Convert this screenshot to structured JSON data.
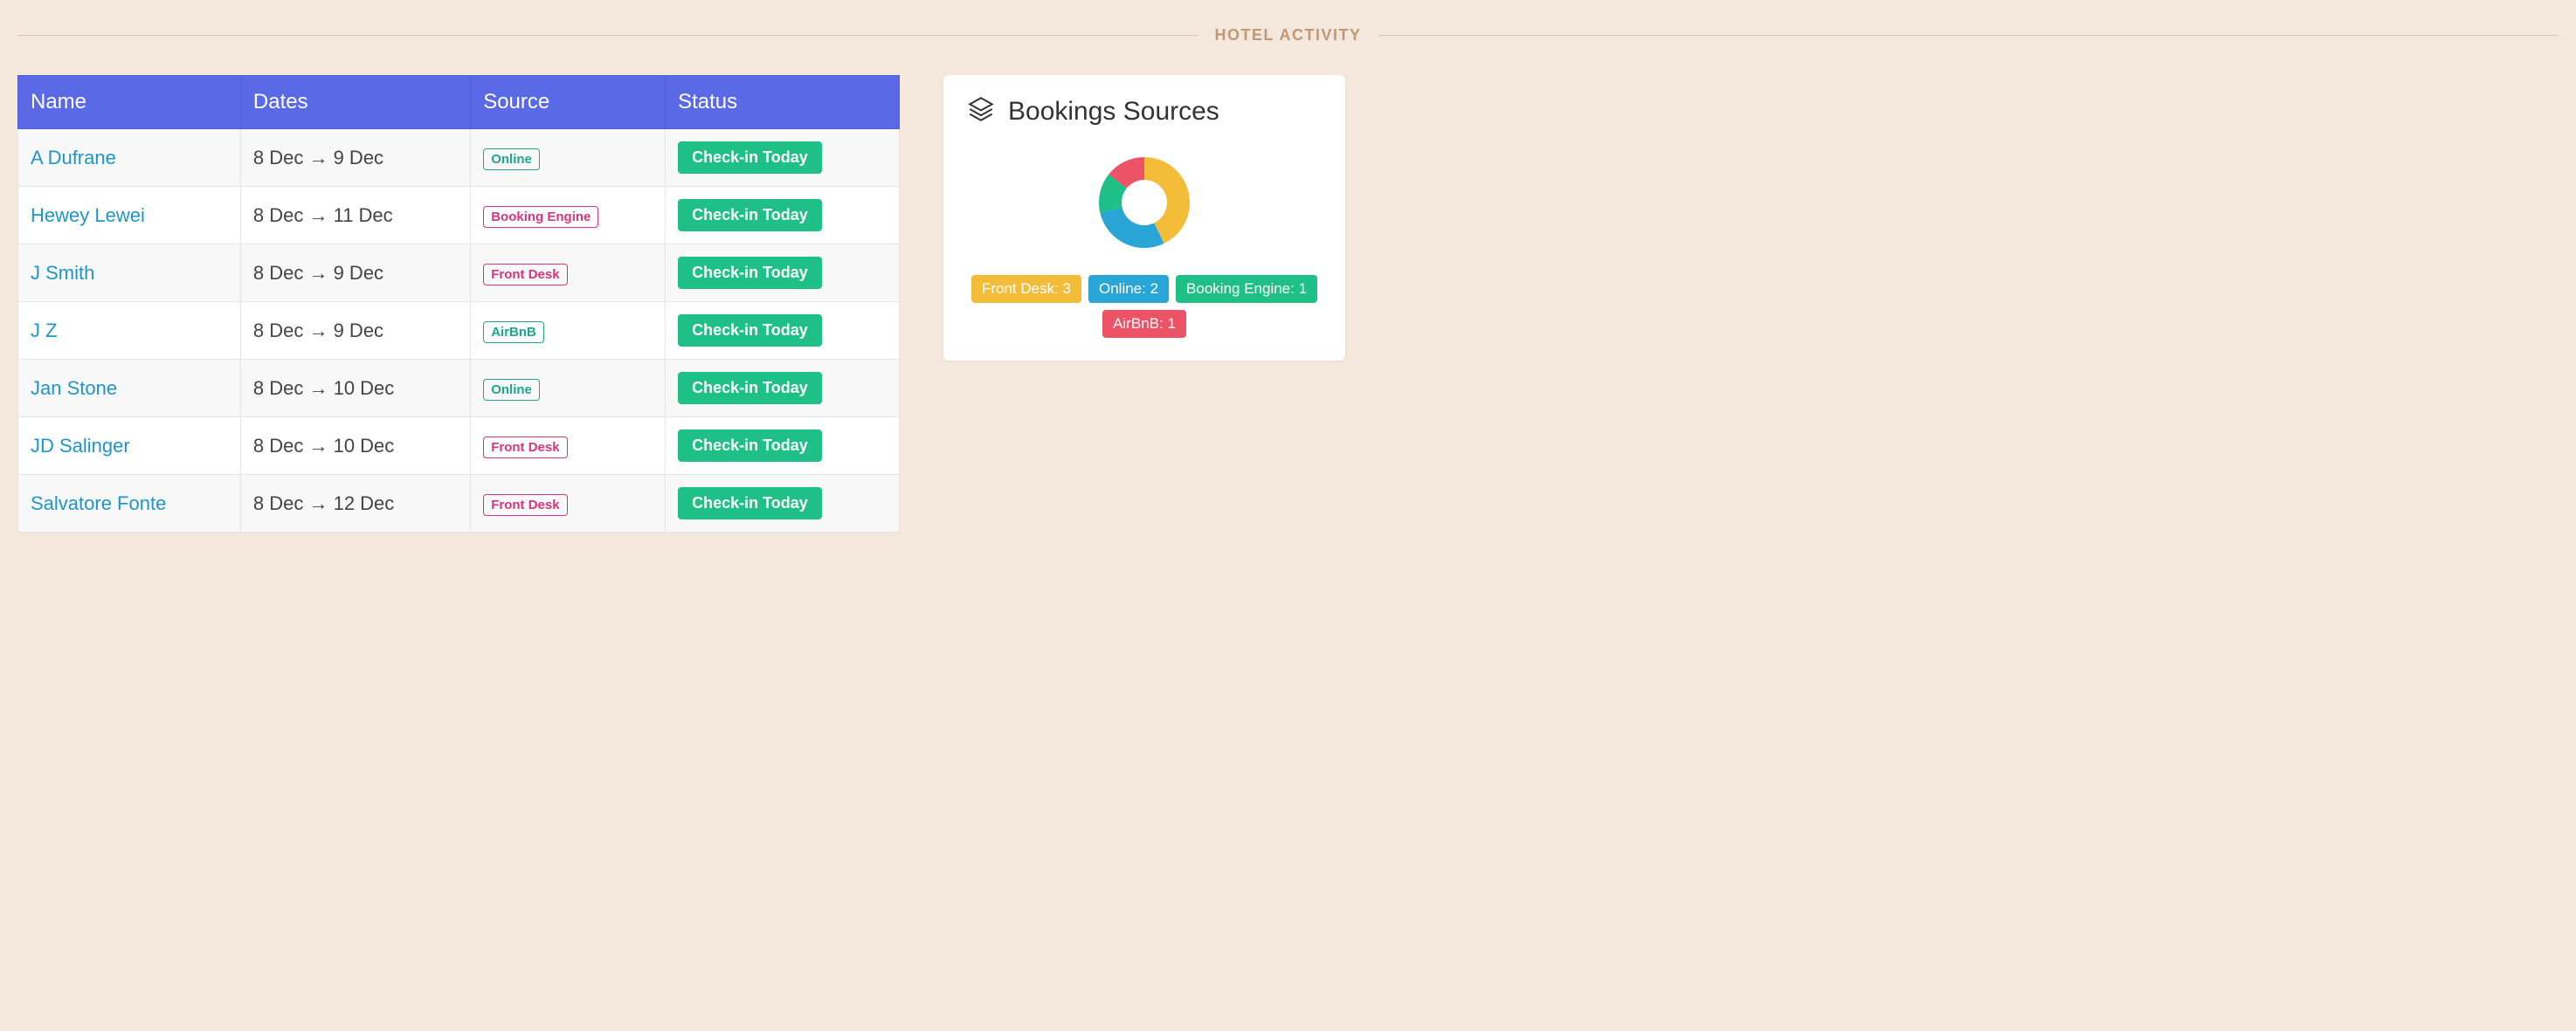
{
  "section_title": "HOTEL ACTIVITY",
  "colors": {
    "header_bg": "#5a6ae6",
    "online": "#1fa58c",
    "booking_engine": "#d6367f",
    "front_desk": "#d6367f",
    "airbnb": "#1fa58c",
    "status_green": "#1fbf88",
    "pill_frontdesk": "#f3bd3a",
    "pill_online": "#2aa6d6",
    "pill_bookingengine": "#1fbf88",
    "pill_airbnb": "#ec5367"
  },
  "table": {
    "headers": {
      "name": "Name",
      "dates": "Dates",
      "source": "Source",
      "status": "Status"
    },
    "rows": [
      {
        "name": "A Dufrane",
        "dates": "8 Dec → 9 Dec",
        "source": "Online",
        "source_key": "online",
        "status": "Check-in Today"
      },
      {
        "name": "Hewey Lewei",
        "dates": "8 Dec → 11 Dec",
        "source": "Booking Engine",
        "source_key": "bookingengine",
        "status": "Check-in Today"
      },
      {
        "name": "J Smith",
        "dates": "8 Dec → 9 Dec",
        "source": "Front Desk",
        "source_key": "frontdesk",
        "status": "Check-in Today"
      },
      {
        "name": "J Z",
        "dates": "8 Dec → 9 Dec",
        "source": "AirBnB",
        "source_key": "airbnb",
        "status": "Check-in Today"
      },
      {
        "name": "Jan Stone",
        "dates": "8 Dec → 10 Dec",
        "source": "Online",
        "source_key": "online",
        "status": "Check-in Today"
      },
      {
        "name": "JD Salinger",
        "dates": "8 Dec → 10 Dec",
        "source": "Front Desk",
        "source_key": "frontdesk",
        "status": "Check-in Today"
      },
      {
        "name": "Salvatore Fonte",
        "dates": "8 Dec → 12 Dec",
        "source": "Front Desk",
        "source_key": "frontdesk",
        "status": "Check-in Today"
      }
    ]
  },
  "card": {
    "title": "Bookings Sources",
    "legend": [
      {
        "label": "Front Desk: 3",
        "key": "frontdesk"
      },
      {
        "label": "Online: 2",
        "key": "online"
      },
      {
        "label": "Booking Engine: 1",
        "key": "bookingengine"
      },
      {
        "label": "AirBnB: 1",
        "key": "airbnb"
      }
    ]
  },
  "chart_data": {
    "type": "pie",
    "title": "Bookings Sources",
    "categories": [
      "Front Desk",
      "Online",
      "Booking Engine",
      "AirBnB"
    ],
    "values": [
      3,
      2,
      1,
      1
    ],
    "colors": [
      "#f3bd3a",
      "#2aa6d6",
      "#1fbf88",
      "#ec5367"
    ]
  }
}
